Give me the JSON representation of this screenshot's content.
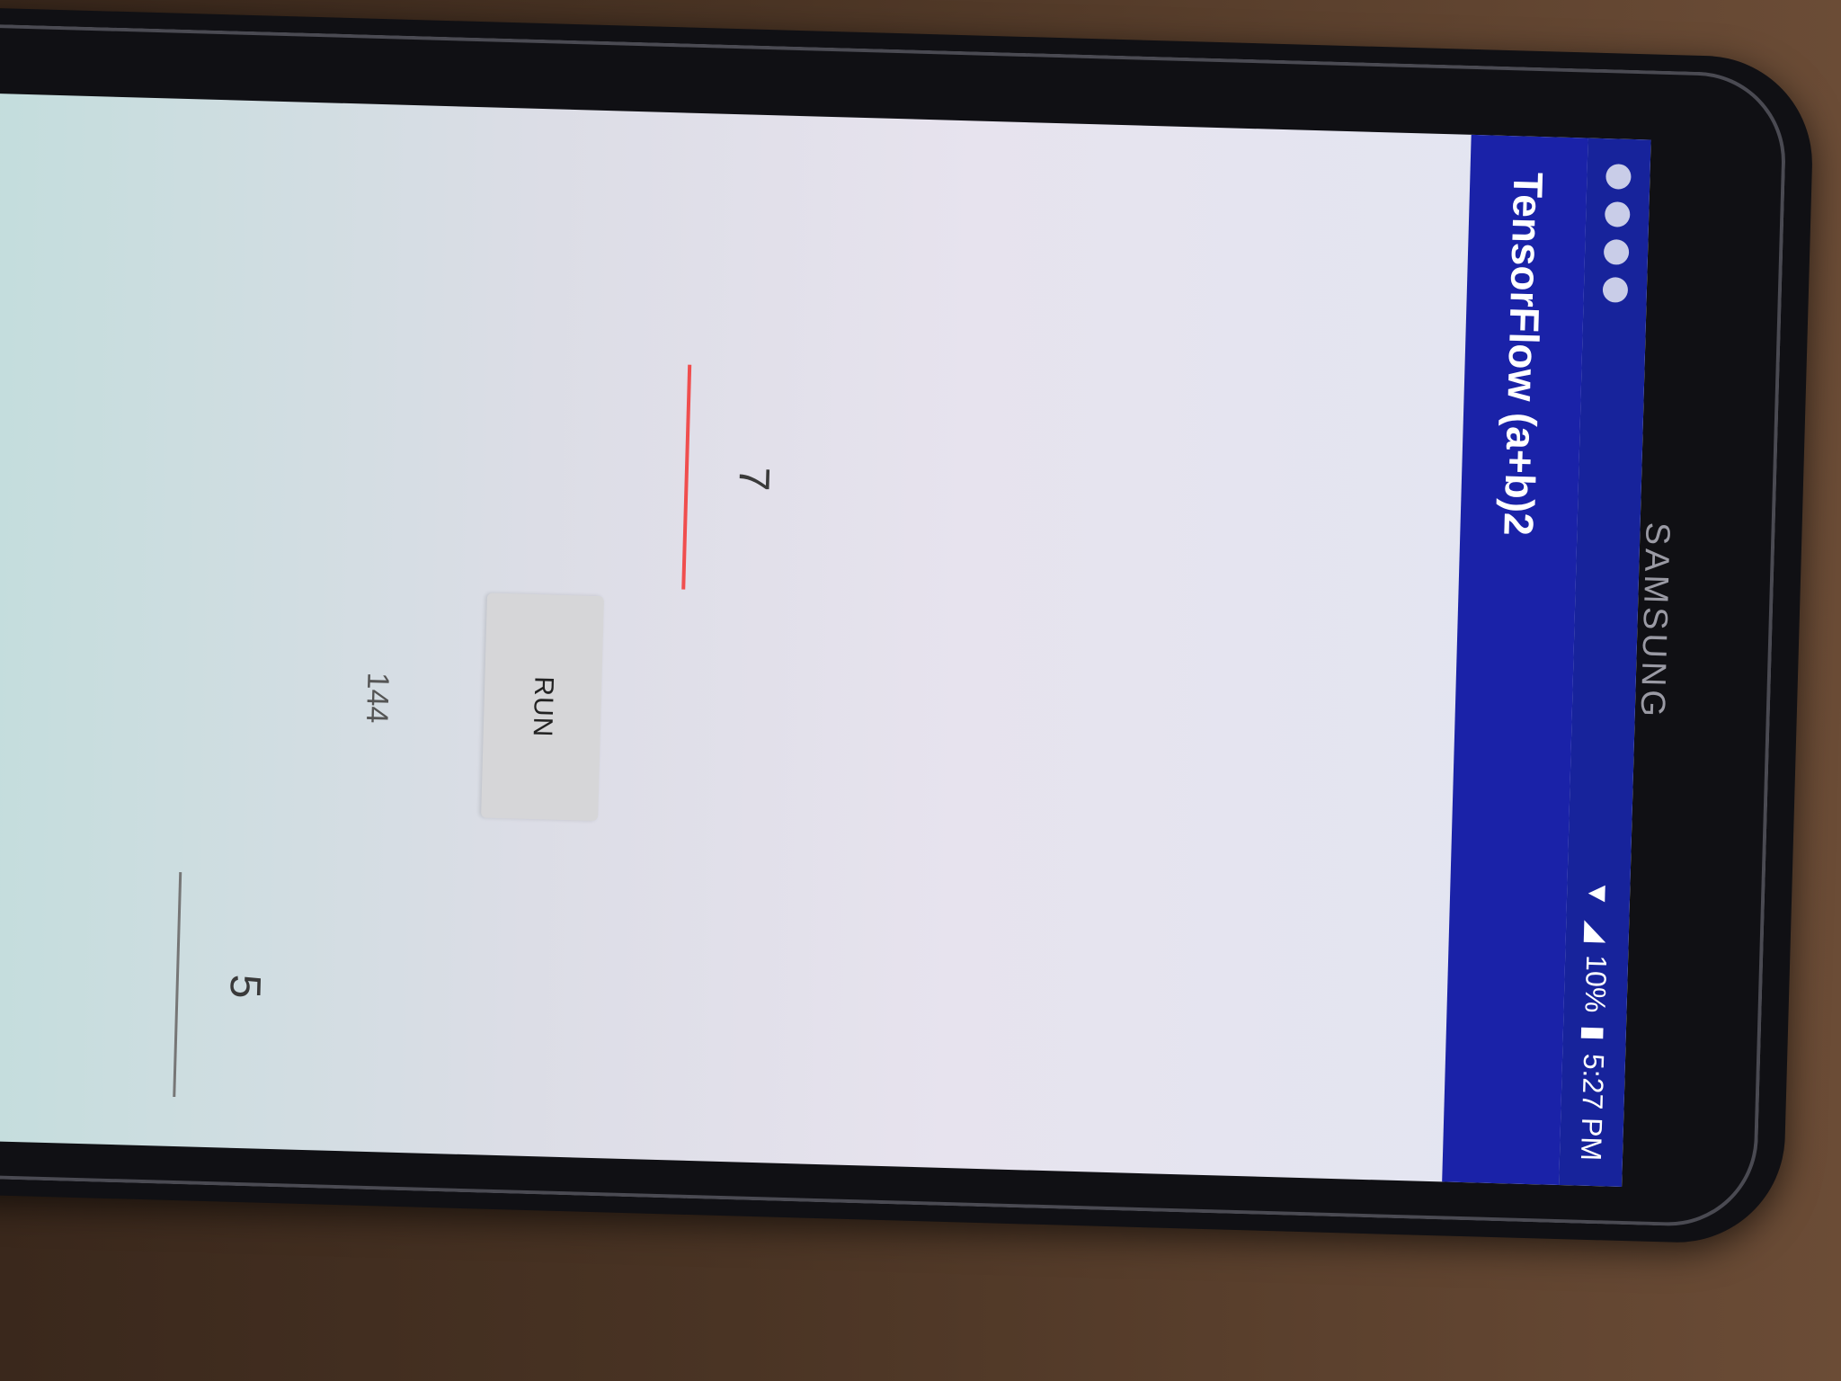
{
  "device": {
    "brand": "SAMSUNG"
  },
  "status_bar": {
    "battery": "10%",
    "time": "5:27 PM",
    "icons": [
      "notification-icon",
      "notification-icon",
      "notification-icon",
      "notification-icon",
      "wifi-icon",
      "signal-icon",
      "battery-icon"
    ]
  },
  "toolbar": {
    "title": "TensorFlow (a+b)2"
  },
  "inputs": {
    "a": {
      "value": "5"
    },
    "b": {
      "value": "7"
    }
  },
  "run_button": {
    "label": "RUN"
  },
  "result": {
    "value": "144"
  },
  "colors": {
    "primary": "#1a22a8",
    "accent_underline": "#f04e4e",
    "button_bg": "#d6d6d8"
  }
}
